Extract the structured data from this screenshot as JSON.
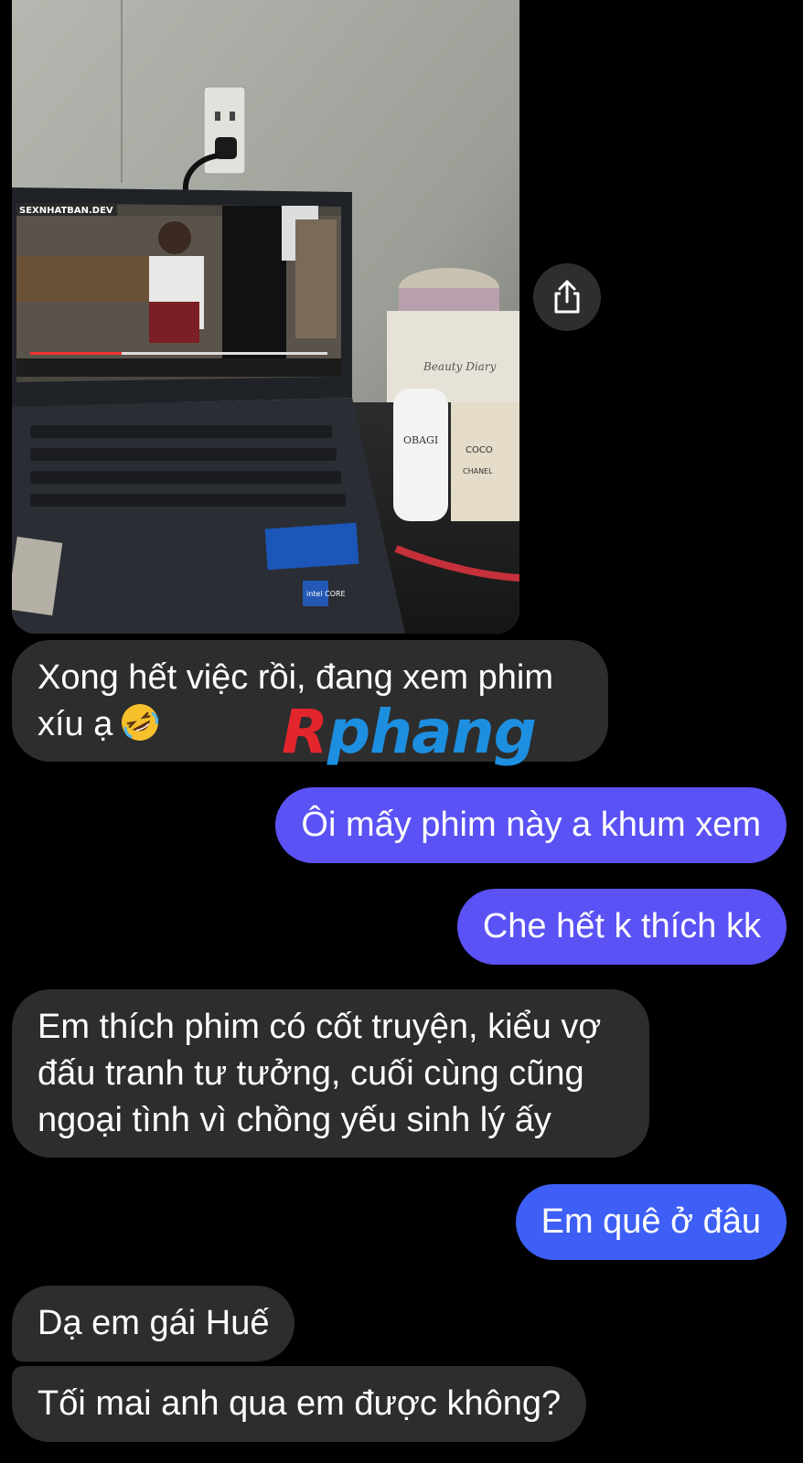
{
  "photo": {
    "site_label": "SEXNHATBAN.DEV",
    "product_labels": [
      "OBAGI",
      "COCO",
      "CHANEL",
      "Beauty Diary"
    ],
    "laptop_badge": "intel CORE"
  },
  "share_icon": "share-icon",
  "watermark": {
    "part1": "R",
    "part2": "phang"
  },
  "messages": [
    {
      "direction": "incoming",
      "lines": [
        "Xong hết việc rồi, đang xem phim",
        "xíu ạ"
      ],
      "emoji": "rolling-on-floor-laughing-emoji"
    },
    {
      "direction": "outgoing",
      "text": "Ôi mấy phim này a khum xem"
    },
    {
      "direction": "outgoing",
      "text": "Che hết k thích kk"
    },
    {
      "direction": "incoming",
      "lines": [
        "Em thích phim có cốt truyện, kiểu vợ",
        "đấu tranh tư tưởng, cuối cùng cũng",
        "ngoại tình vì chồng yếu sinh lý ấy"
      ]
    },
    {
      "direction": "outgoing",
      "text": "Em quê ở đâu"
    },
    {
      "direction": "incoming",
      "text": "Dạ em gái Huế"
    },
    {
      "direction": "incoming",
      "text": "Tối mai anh qua em được không?"
    }
  ],
  "colors": {
    "incoming_bubble": "#2d2d2d",
    "outgoing_bubble_1": "#5a52f4",
    "outgoing_bubble_2": "#3d5ff5",
    "background": "#000000"
  }
}
